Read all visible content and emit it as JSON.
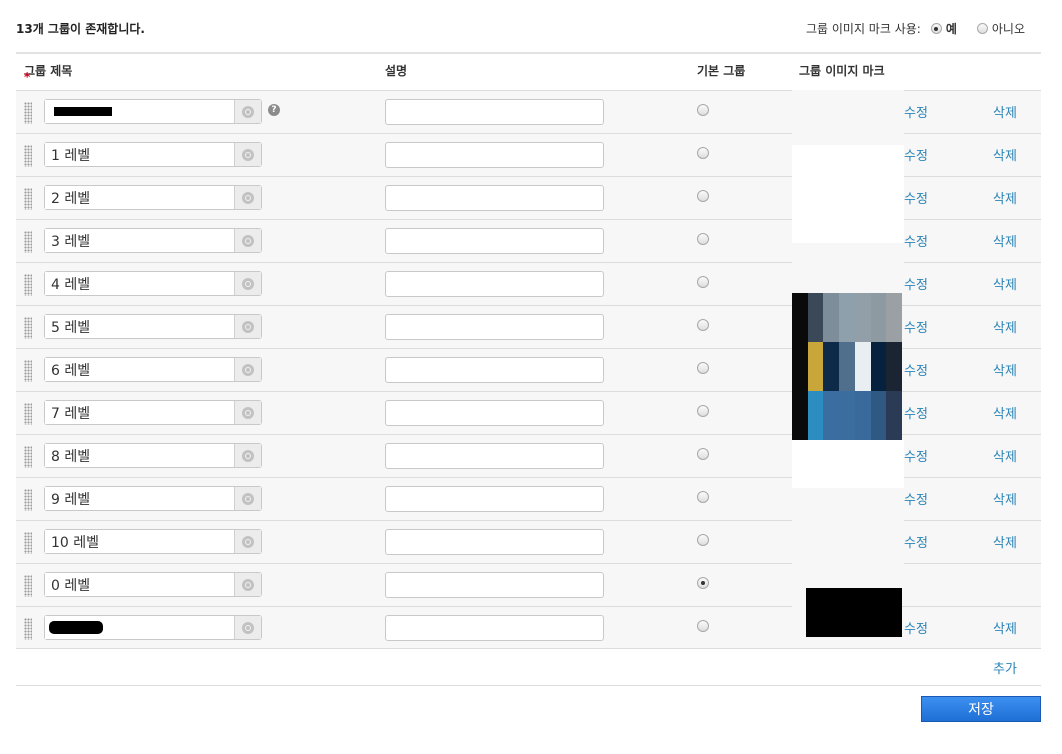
{
  "header": {
    "count_text": "13개 그룹이 존재합니다.",
    "mark_label": "그룹 이미지 마크 사용:",
    "yes_label": "예",
    "no_label": "아니오",
    "mark_use": "yes"
  },
  "columns": {
    "required_marker": "*",
    "title": "그룹 제목",
    "description": "설명",
    "default": "기본 그룹",
    "mark": "그룹 이미지 마크"
  },
  "icons": {
    "drag": "drag-handle-icon",
    "globe": "globe-icon",
    "help": "help-icon",
    "help_glyph": "?"
  },
  "rows": [
    {
      "title": "",
      "redacted": true,
      "description": "",
      "is_default": false,
      "has_help": true,
      "edit_label": "수정",
      "delete_label": "삭제"
    },
    {
      "title": "1 레벨",
      "description": "",
      "is_default": false,
      "edit_label": "수정",
      "delete_label": "삭제"
    },
    {
      "title": "2 레벨",
      "description": "",
      "is_default": false,
      "edit_label": "수정",
      "delete_label": "삭제"
    },
    {
      "title": "3 레벨",
      "description": "",
      "is_default": false,
      "edit_label": "수정",
      "delete_label": "삭제"
    },
    {
      "title": "4 레벨",
      "description": "",
      "is_default": false,
      "edit_label": "수정",
      "delete_label": "삭제"
    },
    {
      "title": "5 레벨",
      "description": "",
      "is_default": false,
      "edit_label": "수정",
      "delete_label": "삭제"
    },
    {
      "title": "6 레벨",
      "description": "",
      "is_default": false,
      "edit_label": "수정",
      "delete_label": "삭제"
    },
    {
      "title": "7 레벨",
      "description": "",
      "is_default": false,
      "edit_label": "수정",
      "delete_label": "삭제"
    },
    {
      "title": "8 레벨",
      "description": "",
      "is_default": false,
      "edit_label": "수정",
      "delete_label": "삭제"
    },
    {
      "title": "9 레벨",
      "description": "",
      "is_default": false,
      "edit_label": "수정",
      "delete_label": "삭제"
    },
    {
      "title": "10 레벨",
      "description": "",
      "is_default": false,
      "edit_label": "수정",
      "delete_label": "삭제"
    },
    {
      "title": "0 레벨",
      "description": "",
      "is_default": true,
      "edit_label": "",
      "delete_label": ""
    },
    {
      "title": "",
      "redacted": true,
      "description": "",
      "is_default": false,
      "edit_label": "수정",
      "delete_label": "삭제"
    }
  ],
  "add_label": "추가",
  "save_label": "저장",
  "mark_image_colors": [
    [
      "#0a0a0a",
      "#3a4858",
      "#7d8e9a",
      "#8fa0ad",
      "#929fa8",
      "#8e9aa2",
      "#9aa0a4"
    ],
    [
      "#0a0a0a",
      "#c9a63a",
      "#0d2a48",
      "#4f6f8c",
      "#e9eef2",
      "#06213e",
      "#1a2433"
    ],
    [
      "#0a0a0a",
      "#2b8dc0",
      "#3b6da0",
      "#3b6e9f",
      "#3a6a9b",
      "#2f5883",
      "#2b3b55"
    ]
  ]
}
